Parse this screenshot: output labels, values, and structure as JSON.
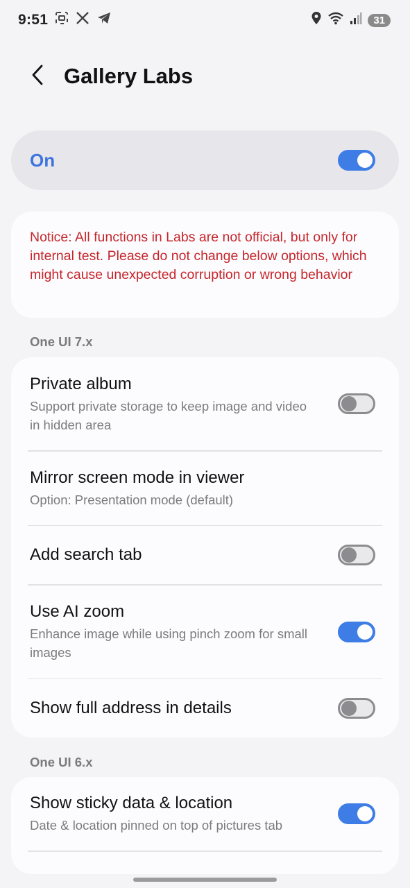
{
  "status_bar": {
    "time": "9:51",
    "icons_left": [
      "screenshot-icon",
      "x-icon",
      "telegram-icon"
    ],
    "icons_right": [
      "location-icon",
      "wifi-icon",
      "signal-icon"
    ],
    "battery": "31"
  },
  "header": {
    "title": "Gallery Labs"
  },
  "master_switch": {
    "label": "On",
    "state": true
  },
  "notice": {
    "text": "Notice: All functions in Labs are not official, but only for internal test. Please do not change below options, which might cause unexpected corruption or wrong behavior",
    "color": "#c5262b"
  },
  "sections": [
    {
      "label": "One UI 7.x",
      "items": [
        {
          "title": "Private album",
          "subtitle": "Support private storage to keep image and video in hidden area",
          "toggle": false
        },
        {
          "title": "Mirror screen mode in viewer",
          "subtitle": "Option: Presentation mode (default)"
        },
        {
          "title": "Add search tab",
          "toggle": false
        },
        {
          "title": "Use AI zoom",
          "subtitle": "Enhance image while using pinch zoom for small images",
          "toggle": true
        },
        {
          "title": "Show full address in details",
          "toggle": false
        }
      ]
    },
    {
      "label": "One UI 6.x",
      "items": [
        {
          "title": "Show sticky data & location",
          "subtitle": "Date & location pinned on top of pictures tab",
          "toggle": true
        }
      ]
    }
  ],
  "colors": {
    "accent": "#3e7ce6",
    "background": "#f4f4f6",
    "card": "#fcfcfe"
  }
}
